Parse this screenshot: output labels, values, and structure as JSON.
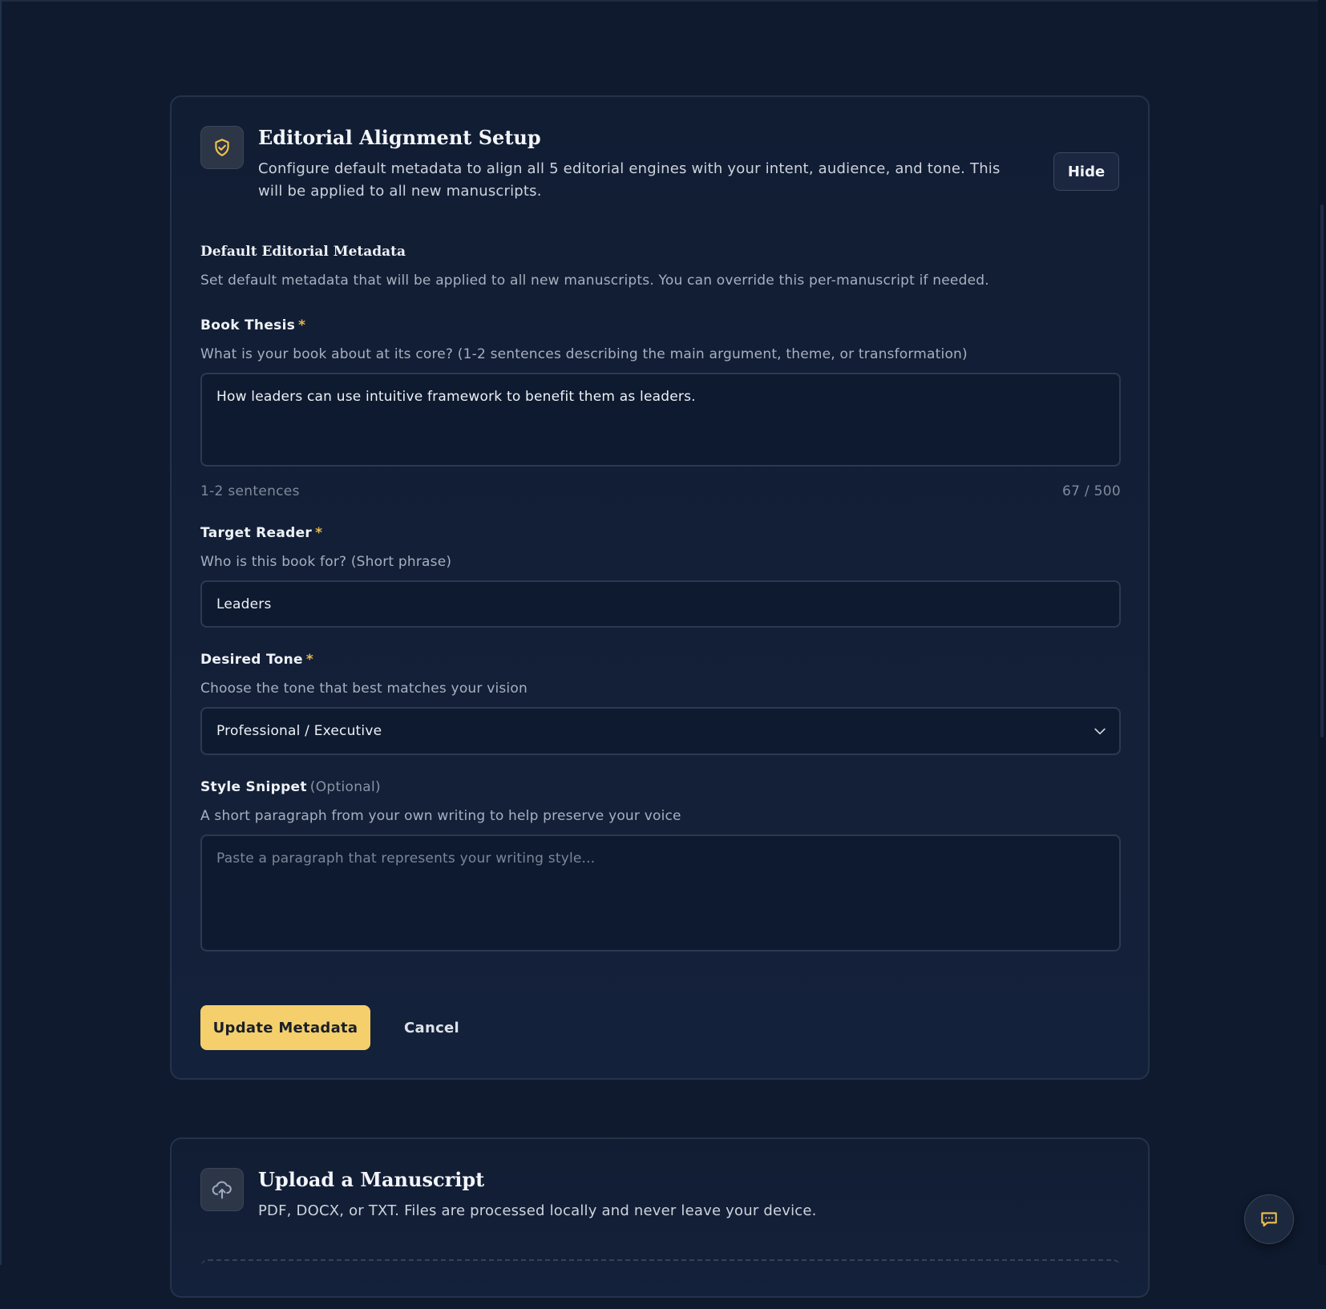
{
  "setup": {
    "title": "Editorial Alignment Setup",
    "description": "Configure default metadata to align all 5 editorial engines with your intent, audience, and tone. This will be applied to all new manuscripts.",
    "hide_label": "Hide",
    "section_title": "Default Editorial Metadata",
    "section_description": "Set default metadata that will be applied to all new manuscripts. You can override this per-manuscript if needed.",
    "required_marker": "*",
    "thesis": {
      "label": "Book Thesis",
      "help": "What is your book about at its core? (1-2 sentences describing the main argument, theme, or transformation)",
      "value": "How leaders can use intuitive framework to benefit them as leaders.",
      "hint": "1-2 sentences",
      "counter": "67 / 500"
    },
    "reader": {
      "label": "Target Reader",
      "help": "Who is this book for? (Short phrase)",
      "value": "Leaders"
    },
    "tone": {
      "label": "Desired Tone",
      "help": "Choose the tone that best matches your vision",
      "selected": "Professional / Executive"
    },
    "style": {
      "label": "Style Snippet",
      "optional": "(Optional)",
      "help": "A short paragraph from your own writing to help preserve your voice",
      "placeholder": "Paste a paragraph that represents your writing style..."
    },
    "update_label": "Update Metadata",
    "cancel_label": "Cancel"
  },
  "upload": {
    "title": "Upload a Manuscript",
    "description": "PDF, DOCX, or TXT. Files are processed locally and never leave your device."
  },
  "colors": {
    "background": "#0f1a2e",
    "accent": "#f4cf6b",
    "required": "#e9b949"
  },
  "icons": {
    "setup": "shield-check-icon",
    "upload": "cloud-upload-icon",
    "chat": "chat-icon",
    "select": "chevron-down-icon"
  }
}
